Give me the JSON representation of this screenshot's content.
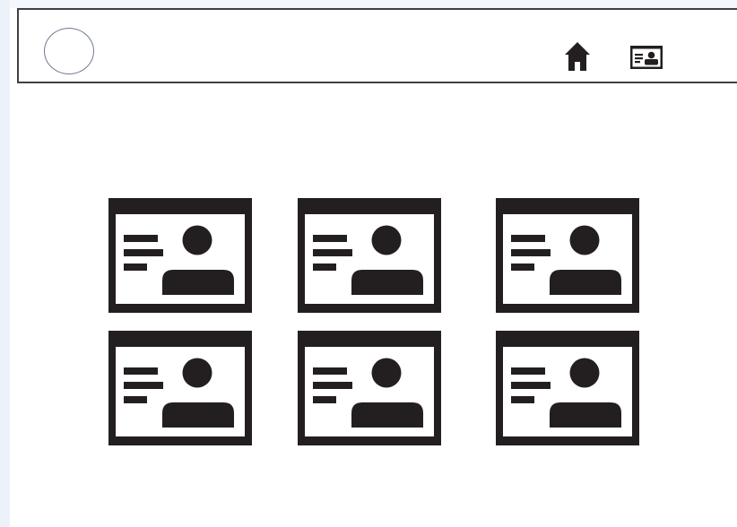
{
  "header": {
    "logo_icon": "circle-logo",
    "nav": [
      {
        "name": "home",
        "icon": "home-icon"
      },
      {
        "name": "profiles",
        "icon": "contact-card-icon"
      }
    ]
  },
  "main": {
    "cards_icon": "profile-card-icon",
    "card_count": 6,
    "columns": 3,
    "rows": 2
  },
  "colors": {
    "icon_fill": "#231f20",
    "header_border": "#3e4247",
    "logo_outline": "#6f7b92",
    "side_strip": "#edf2fa"
  }
}
